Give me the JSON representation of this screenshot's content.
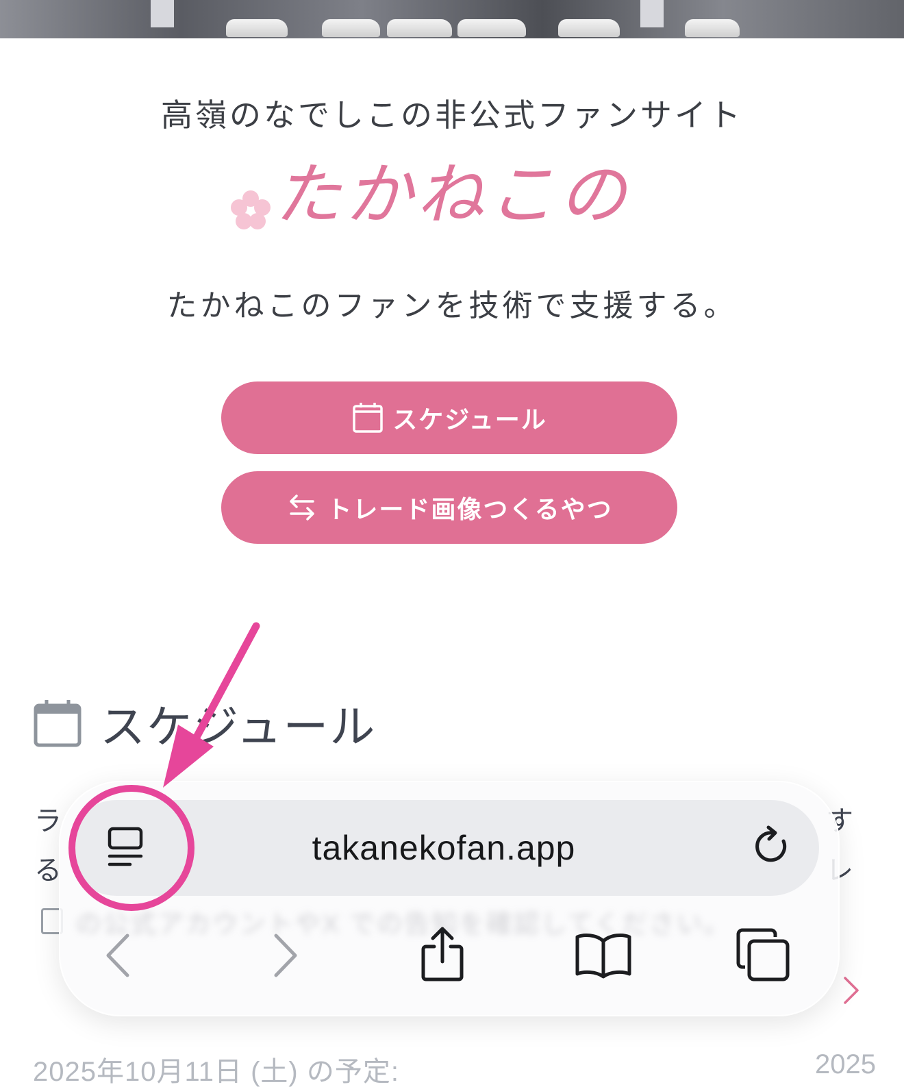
{
  "hero": {
    "description_icon": "hero-photo"
  },
  "header": {
    "subtitle": "高嶺のなでしこの非公式ファンサイト",
    "logo": "たかねこの",
    "tagline": "たかねこのファンを技術で支援する。"
  },
  "buttons": {
    "schedule": {
      "label": "スケジュール",
      "icon": "calendar-icon"
    },
    "trade": {
      "label": "トレード画像つくるやつ",
      "icon": "swap-arrows-icon"
    }
  },
  "section": {
    "title": "スケジュール",
    "icon": "calendar-icon",
    "peek_left_1": "ラ",
    "peek_left_2": "る",
    "peek_right_1": "す",
    "peek_right_2": "レ",
    "date_left": "2025年10月11日 (土) の予定:",
    "date_right": "2025"
  },
  "browser": {
    "url": "takanekofan.app",
    "blurred_line": "の公式アカウントやX での告知を確認してください。",
    "icons": {
      "reader": "page-menu-icon",
      "reload": "reload-icon",
      "back": "back-chevron-icon",
      "forward": "forward-chevron-icon",
      "share": "share-icon",
      "bookmarks": "bookmarks-icon",
      "tabs": "tabs-icon"
    }
  },
  "colors": {
    "accent": "#e07094",
    "logo": "#e0769b",
    "annotation": "#e6469a"
  }
}
